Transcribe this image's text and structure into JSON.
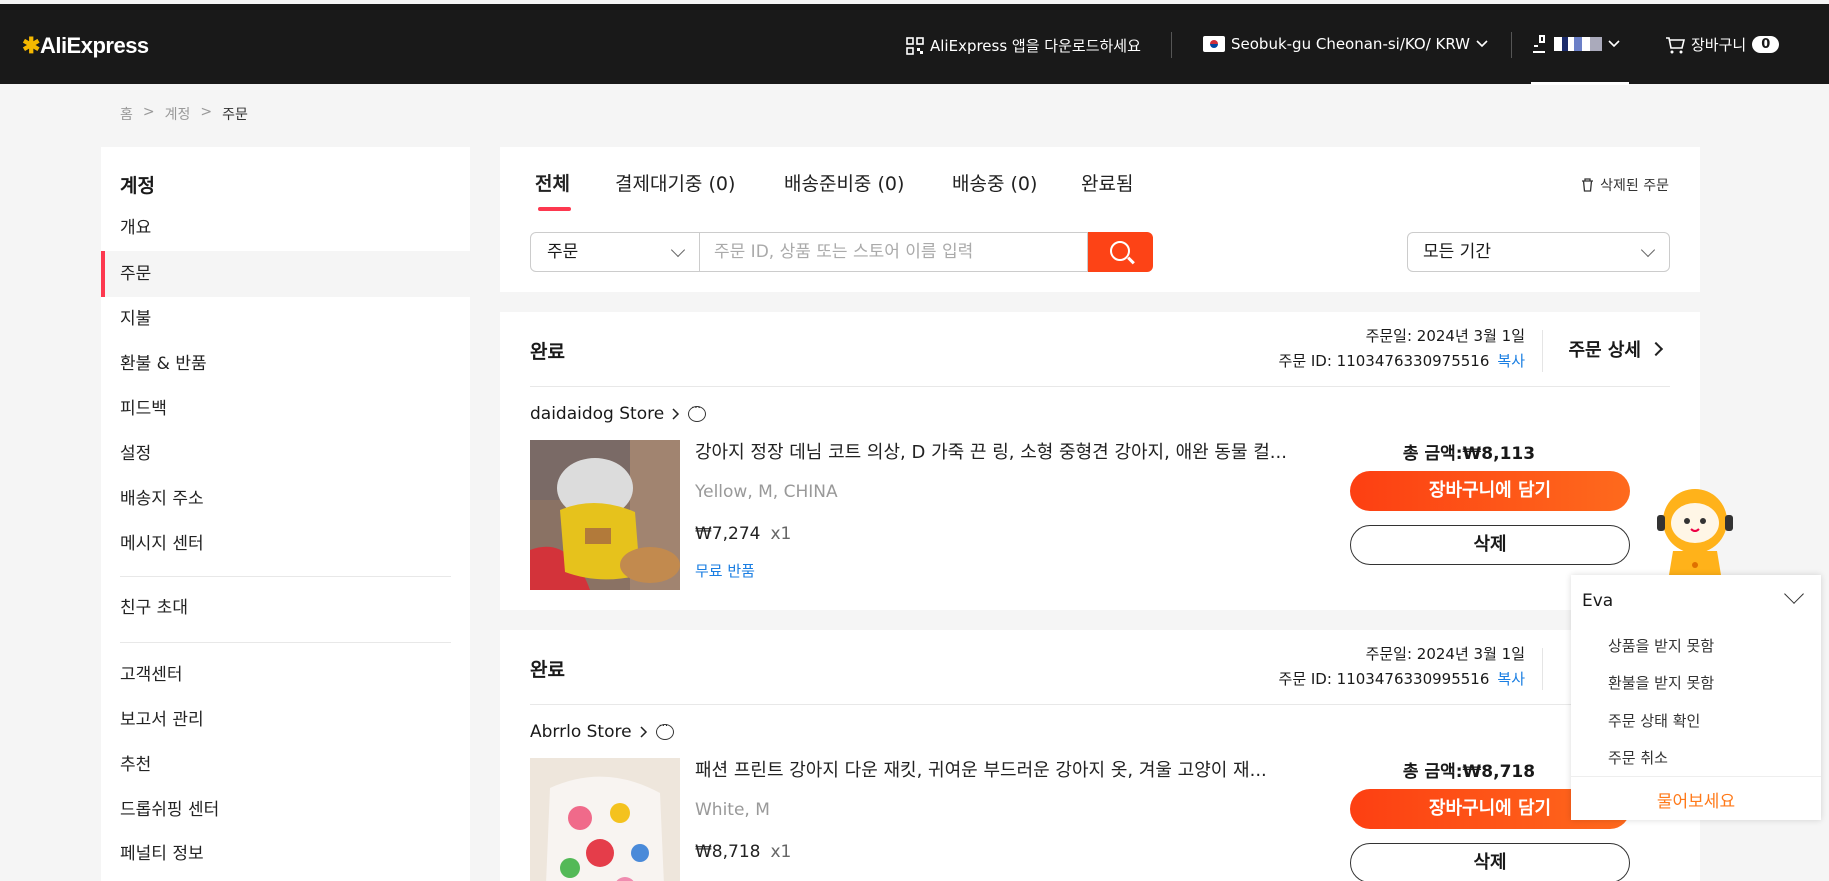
{
  "header": {
    "logo": "AliExpress",
    "app_download": "AliExpress 앱을 다운로드하세요",
    "locale": "Seobuk-gu Cheonan-si/KO/ KRW",
    "cart_label": "장바구니",
    "cart_count": "0"
  },
  "breadcrumb": {
    "home": "홈",
    "account": "계정",
    "current": "주문",
    "sep": ">"
  },
  "sidebar": {
    "title": "계정",
    "items": [
      {
        "label": "개요"
      },
      {
        "label": "주문"
      },
      {
        "label": "지불"
      },
      {
        "label": "환불 & 반품"
      },
      {
        "label": "피드백"
      },
      {
        "label": "설정"
      },
      {
        "label": "배송지 주소"
      },
      {
        "label": "메시지 센터"
      },
      {
        "label": "친구 초대"
      },
      {
        "label": "고객센터"
      },
      {
        "label": "보고서 관리"
      },
      {
        "label": "추천"
      },
      {
        "label": "드롭쉬핑 센터"
      },
      {
        "label": "페널티 정보"
      }
    ]
  },
  "tabs": {
    "all": "전체",
    "pending_payment": "결제대기중 (0)",
    "preparing": "배송준비중 (0)",
    "shipping": "배송중 (0)",
    "completed": "완료됨",
    "deleted_orders": "삭제된 주문"
  },
  "search": {
    "type_select": "주문",
    "placeholder": "주문 ID, 상품 또는 스토어 이름 입력",
    "period": "모든 기간"
  },
  "orders": [
    {
      "status": "완료",
      "date": "주문일: 2024년 3월 1일",
      "order_id": "주문 ID: 1103476330975516",
      "copy": "복사",
      "details": "주문 상세",
      "store": "daidaidog Store",
      "product_name": "강아지 정장 데님 코트 의상, D 가죽 끈 링, 소형 중형견 강아지, 애완 동물 컬...",
      "sku": "Yellow, M, CHINA",
      "price": "₩7,274",
      "qty": "x1",
      "free_return": "무료 반품",
      "total": "총 금액:₩8,113",
      "add_cart": "장바구니에 담기",
      "delete": "삭제"
    },
    {
      "status": "완료",
      "date": "주문일: 2024년 3월 1일",
      "order_id": "주문 ID: 1103476330995516",
      "copy": "복사",
      "store": "Abrrlo Store",
      "product_name": "패션 프린트 강아지 다운 재킷, 귀여운 부드러운 강아지 옷, 겨울 고양이 재...",
      "sku": "White, M",
      "price": "₩8,718",
      "qty": "x1",
      "total": "총 금액:₩8,718",
      "add_cart": "장바구니에 담기",
      "delete": "삭제"
    }
  ],
  "chat": {
    "agent": "Eva",
    "quick_questions": [
      "상품을 받지 못함",
      "환불을 받지 못함",
      "주문 상태 확인",
      "주문 취소"
    ],
    "ask": "물어보세요"
  },
  "colors": {
    "accent": "#fd4316",
    "link": "#1a7ee2",
    "header_bg": "#191919",
    "tab_indicator": "#fd384f"
  }
}
